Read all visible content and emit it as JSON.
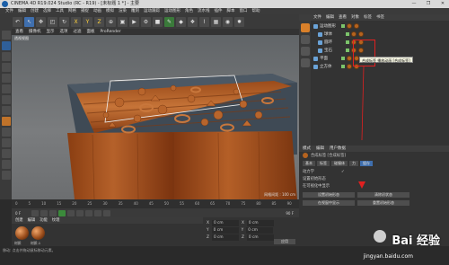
{
  "window": {
    "title": "CINEMA 4D R19.024 Studio (RC - R19) - [未标题 1 *] - 主要",
    "controls": [
      "—",
      "❐",
      "✕"
    ]
  },
  "menubar": [
    "文件",
    "编辑",
    "创建",
    "选择",
    "工具",
    "网格",
    "捕捉",
    "动画",
    "模拟",
    "渲染",
    "雕刻",
    "运动跟踪",
    "运动图形",
    "角色",
    "流水线",
    "插件",
    "脚本",
    "窗口",
    "帮助"
  ],
  "toolbar": {
    "axis_x": "X",
    "axis_y": "Y",
    "axis_z": "Z"
  },
  "viewport": {
    "menu": [
      "查看",
      "摄像机",
      "显示",
      "选项",
      "过滤",
      "面板",
      "ProRender"
    ],
    "label": "透视视图",
    "grid_scale": "网格间距 : 100 cm"
  },
  "object_manager": {
    "tabs": [
      "文件",
      "编辑",
      "查看",
      "对象",
      "标签",
      "书签"
    ],
    "rows": [
      {
        "name": "运动图形",
        "indent": 0
      },
      {
        "name": "球体",
        "indent": 1
      },
      {
        "name": "圆环",
        "indent": 1
      },
      {
        "name": "宝石",
        "indent": 1
      },
      {
        "name": "平面",
        "indent": 0
      },
      {
        "name": "立方体",
        "indent": 0
      }
    ],
    "tooltip": "合成标签 播放动画 [合成标签]"
  },
  "attributes": {
    "tabs": [
      "模式",
      "编辑",
      "用户数据"
    ],
    "header": "合成标签 [合成标签]",
    "subtabs": [
      "基本",
      "标签",
      "碰撞体",
      "力",
      "缓存"
    ],
    "rows": [
      {
        "label": "动力学",
        "value": "✓"
      },
      {
        "label": "设置初始形态",
        "value": ""
      },
      {
        "label": "在可视化中显示",
        "value": ""
      }
    ],
    "buttons": [
      "设置初始形态",
      "清除初状态",
      "在视窗中显示",
      "重置初始形态"
    ]
  },
  "timeline": {
    "ticks": [
      "0",
      "5",
      "10",
      "15",
      "20",
      "25",
      "30",
      "35",
      "40",
      "45",
      "50",
      "55",
      "60",
      "65",
      "70",
      "75",
      "80",
      "85",
      "90"
    ],
    "current_frame": "0 F",
    "end_frame": "90 F"
  },
  "material_manager": {
    "menu": [
      "创建",
      "编辑",
      "功能",
      "纹理"
    ],
    "materials": [
      "材质",
      "材质.1"
    ]
  },
  "coordinates": {
    "rows": [
      {
        "axis": "X",
        "value": "0 cm",
        "axis2": "X",
        "value2": "0 cm"
      },
      {
        "axis": "Y",
        "value": "0 cm",
        "axis2": "Y",
        "value2": "0 cm"
      },
      {
        "axis": "Z",
        "value": "0 cm",
        "axis2": "Z",
        "value2": "0 cm"
      }
    ],
    "apply": "应用"
  },
  "status": "移动: 点击并拖动鼠标移动元素。",
  "watermark": {
    "brand": "Bai 经验",
    "url": "jingyan.baidu.com"
  },
  "colors": {
    "accent": "#3f6fae",
    "highlight": "#d9802a",
    "annotation": "#e02020"
  }
}
